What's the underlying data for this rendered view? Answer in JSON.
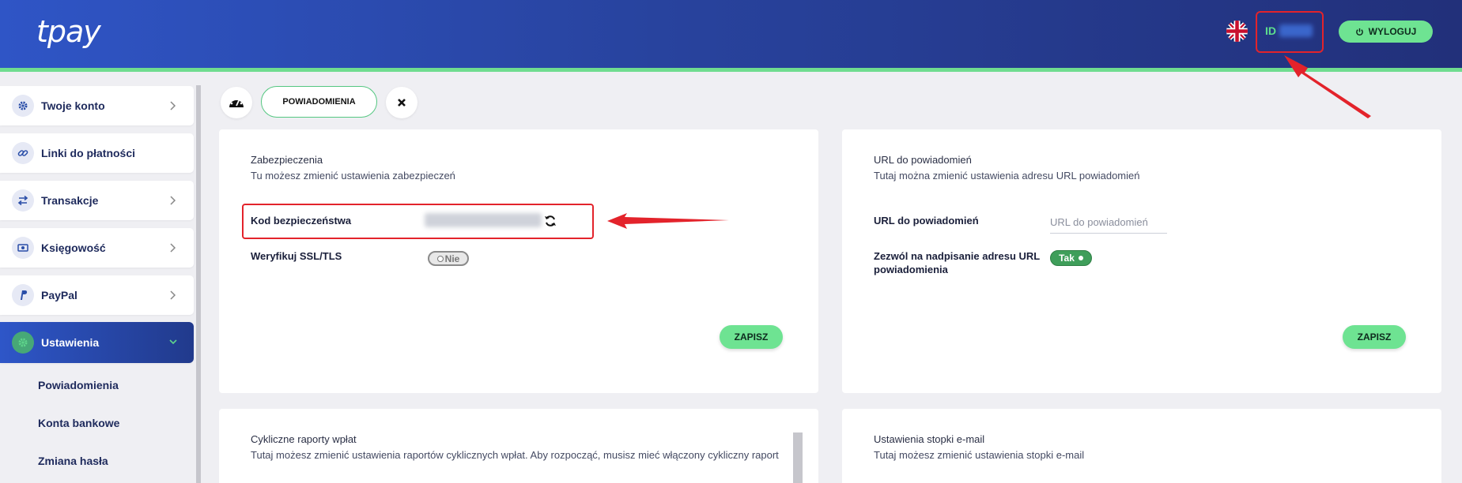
{
  "header": {
    "logo": "tpay",
    "language_icon": "uk-flag-icon",
    "id_label": "ID",
    "logout_label": "WYLOGUJ",
    "logout_icon": "power-icon"
  },
  "sidebar": {
    "items": [
      {
        "label": "Twoje konto",
        "icon": "gear-icon"
      },
      {
        "label": "Linki do płatności",
        "icon": "link-icon"
      },
      {
        "label": "Transakcje",
        "icon": "arrows-icon"
      },
      {
        "label": "Księgowość",
        "icon": "money-icon"
      },
      {
        "label": "PayPal",
        "icon": "paypal-icon"
      },
      {
        "label": "Ustawienia",
        "icon": "settings-icon",
        "active": true
      }
    ],
    "subitems": [
      "Powiadomienia",
      "Konta bankowe",
      "Zmiana hasła"
    ]
  },
  "toolbar": {
    "tab_label": "POWIADOMIENIA"
  },
  "security_card": {
    "title": "Zabezpieczenia",
    "subtitle": "Tu możesz zmienić ustawienia zabezpieczeń",
    "security_code_label": "Kod bezpieczeństwa",
    "ssl_label": "Weryfikuj SSL/TLS",
    "ssl_value": "Nie",
    "save_label": "ZAPISZ"
  },
  "url_card": {
    "title": "URL do powiadomień",
    "subtitle": "Tutaj można zmienić ustawienia adresu URL powiadomień",
    "url_label": "URL do powiadomień",
    "url_placeholder": "URL do powiadomień",
    "override_label": "Zezwól na nadpisanie adresu URL powiadomienia",
    "override_value": "Tak",
    "save_label": "ZAPISZ"
  },
  "reports_card": {
    "title": "Cykliczne raporty wpłat",
    "subtitle": "Tutaj możesz zmienić ustawienia raportów cyklicznych wpłat. Aby rozpocząć, musisz mieć włączony cykliczny raport"
  },
  "footer_card": {
    "title": "Ustawienia stopki e-mail",
    "subtitle": "Tutaj możesz zmienić ustawienia stopki e-mail"
  },
  "colors": {
    "header_start": "#2f55c6",
    "header_end": "#22307a",
    "accent_green": "#6ee392",
    "annotation_red": "#e3232b"
  }
}
